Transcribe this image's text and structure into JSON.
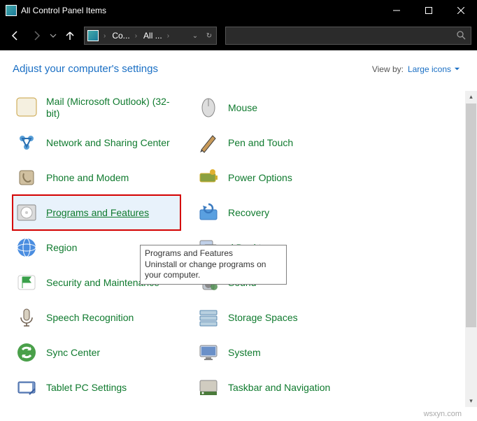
{
  "window": {
    "title": "All Control Panel Items"
  },
  "breadcrumb": {
    "seg1": "Co...",
    "seg2": "All ..."
  },
  "header": {
    "adjust": "Adjust your computer's settings",
    "viewby_label": "View by:",
    "viewby_value": "Large icons"
  },
  "left_items": [
    {
      "label": "Mail (Microsoft Outlook) (32-bit)",
      "icon": "mail-icon"
    },
    {
      "label": "Network and Sharing Center",
      "icon": "network-icon"
    },
    {
      "label": "Phone and Modem",
      "icon": "phone-icon"
    },
    {
      "label": "Programs and Features",
      "icon": "programs-icon",
      "selected": true
    },
    {
      "label": "Region",
      "icon": "region-icon"
    },
    {
      "label": "Security and Maintenance",
      "icon": "security-icon"
    },
    {
      "label": "Speech Recognition",
      "icon": "speech-icon"
    },
    {
      "label": "Sync Center",
      "icon": "sync-icon"
    },
    {
      "label": "Tablet PC Settings",
      "icon": "tablet-icon"
    }
  ],
  "right_items": [
    {
      "label": "Mouse",
      "icon": "mouse-icon"
    },
    {
      "label": "Pen and Touch",
      "icon": "pen-icon"
    },
    {
      "label": "Power Options",
      "icon": "power-icon"
    },
    {
      "label": "Recovery",
      "icon": "recovery-icon"
    },
    {
      "label": "RemoteApp and Desktop Connections",
      "icon": "remoteapp-icon",
      "truncated": "d Desktop"
    },
    {
      "label": "Sound",
      "icon": "sound-icon"
    },
    {
      "label": "Storage Spaces",
      "icon": "storage-icon"
    },
    {
      "label": "System",
      "icon": "system-icon"
    },
    {
      "label": "Taskbar and Navigation",
      "icon": "taskbar-icon"
    }
  ],
  "tooltip": {
    "title": "Programs and Features",
    "body": "Uninstall or change programs on your computer."
  },
  "watermark": "wsxyn.com",
  "icon_colors": {
    "mail-icon": [
      "#f5f0e0",
      "#c8a040",
      "#4a8",
      "radial"
    ],
    "network-icon": [
      "#5aa0d8",
      "#2a6fb0",
      "net"
    ],
    "phone-icon": [
      "#d0c0a0",
      "#8a7a5a",
      "phone"
    ],
    "programs-icon": [
      "#dcdcdc",
      "#888",
      "cd"
    ],
    "region-icon": [
      "#4a8de0",
      "#1a5fb0",
      "globe"
    ],
    "security-icon": [
      "#3aa04a",
      "#fff",
      "flag"
    ],
    "speech-icon": [
      "#d8d0c0",
      "#6a5a4a",
      "mic"
    ],
    "sync-icon": [
      "#4aa04a",
      "#fff",
      "sync"
    ],
    "tablet-icon": [
      "#7a98c8",
      "#3a5fa0",
      "tablet"
    ],
    "mouse-icon": [
      "#ddd",
      "#888",
      "mouse"
    ],
    "pen-icon": [
      "#c89a5a",
      "#3a3a3a",
      "pen"
    ],
    "power-icon": [
      "#8aa040",
      "#d0b030",
      "battery"
    ],
    "recovery-icon": [
      "#5aa0e0",
      "#3a7ac0",
      "recovery"
    ],
    "remoteapp-icon": [
      "#6a90c8",
      "#c0d0e8",
      "remote"
    ],
    "sound-icon": [
      "#c0c8d0",
      "#4a8a4a",
      "speaker"
    ],
    "storage-icon": [
      "#b8d0e0",
      "#5a8ab0",
      "drives"
    ],
    "system-icon": [
      "#6a90c8",
      "#c0d0e8",
      "monitor"
    ],
    "taskbar-icon": [
      "#4a7a3a",
      "#d0ccc0",
      "taskbar"
    ]
  }
}
